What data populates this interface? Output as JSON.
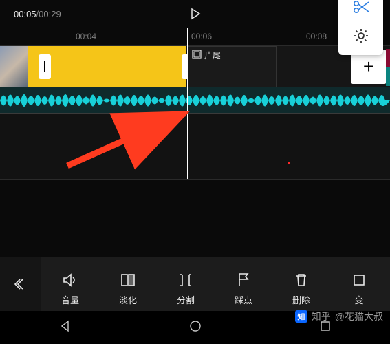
{
  "playback": {
    "current": "00:05",
    "total": "00:29"
  },
  "ruler": {
    "t1": "00:04",
    "t2": "00:06",
    "t3": "00:08"
  },
  "clip_end_label": "片尾",
  "add_symbol": "+",
  "tools": [
    {
      "label": "音量"
    },
    {
      "label": "淡化"
    },
    {
      "label": "分割"
    },
    {
      "label": "踩点"
    },
    {
      "label": "删除"
    },
    {
      "label": "变"
    }
  ],
  "watermark": {
    "site": "知乎",
    "user": "@花猫大叔"
  }
}
